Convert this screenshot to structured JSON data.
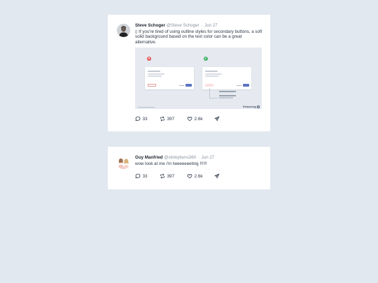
{
  "tweets": [
    {
      "author_name": "Steve Schoger",
      "handle": "@Steve Schoger",
      "separator": "·",
      "date": "Jun 27",
      "text": "▯ If you're tired of using outline styles for secondary buttons, a soft solid background based on the text color can be a great alternative.",
      "avatar_icon": "person-photo",
      "has_media": true,
      "media_brand": "Refactoring",
      "counts": {
        "replies": "33",
        "retweets": "397",
        "likes": "2.6k"
      }
    },
    {
      "author_name": "Guy Manfried",
      "handle": "@stinkybuns360",
      "separator": "·",
      "date": "Jun 27",
      "text": "wow look at me i'm tweeeeeeting !!!!!!",
      "avatar_icon": "people-photo",
      "has_media": false,
      "counts": {
        "replies": "33",
        "retweets": "397",
        "likes": "2.6k"
      }
    }
  ],
  "icons": {
    "reply": "comment-bubble-icon",
    "retweet": "retweet-arrows-icon",
    "like": "heart-icon",
    "share": "send-plane-icon"
  },
  "colors": {
    "page_background": "#e2e8f0",
    "card_background": "#ffffff",
    "muted_text": "#8a94a3",
    "bad_marker": "#e05353",
    "good_marker": "#47b26b",
    "primary_button": "#5b73c4"
  }
}
